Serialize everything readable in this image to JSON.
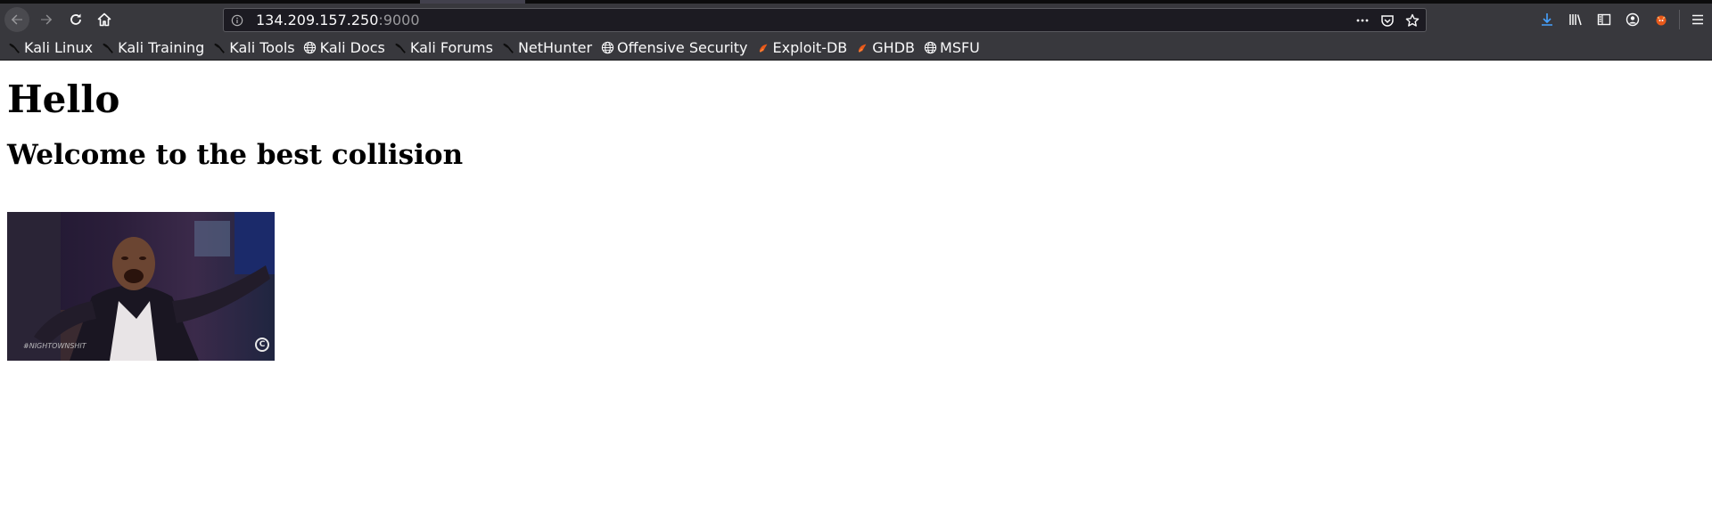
{
  "browser": {
    "url": {
      "host": "134.209.157.250",
      "port": ":9000"
    },
    "toolbar_icons": [
      "back-icon",
      "forward-icon",
      "reload-icon",
      "home-icon",
      "page-actions-icon",
      "pocket-icon",
      "bookmark-star-icon",
      "download-icon",
      "library-icon",
      "sidebar-icon",
      "account-icon",
      "extension-icon",
      "menu-icon"
    ],
    "bookmarks": [
      {
        "label": "Kali Linux",
        "icon": "kali-dragon-icon"
      },
      {
        "label": "Kali Training",
        "icon": "kali-dragon-icon"
      },
      {
        "label": "Kali Tools",
        "icon": "kali-dragon-icon"
      },
      {
        "label": "Kali Docs",
        "icon": "globe-icon"
      },
      {
        "label": "Kali Forums",
        "icon": "kali-dragon-icon"
      },
      {
        "label": "NetHunter",
        "icon": "kali-dragon-icon"
      },
      {
        "label": "Offensive Security",
        "icon": "globe-icon"
      },
      {
        "label": "Exploit-DB",
        "icon": "exploitdb-icon"
      },
      {
        "label": "GHDB",
        "icon": "exploitdb-icon"
      },
      {
        "label": "MSFU",
        "icon": "globe-icon"
      }
    ],
    "colors": {
      "chrome": "#38383d",
      "urlbar": "#1c1b22",
      "download_accent": "#45a1ff",
      "exploitdb_orange": "#e8591a"
    }
  },
  "page": {
    "heading": "Hello",
    "subheading": "Welcome to the best collision",
    "gif": {
      "watermark": "#NIGHTOWNSHIT",
      "logo": "C"
    }
  }
}
